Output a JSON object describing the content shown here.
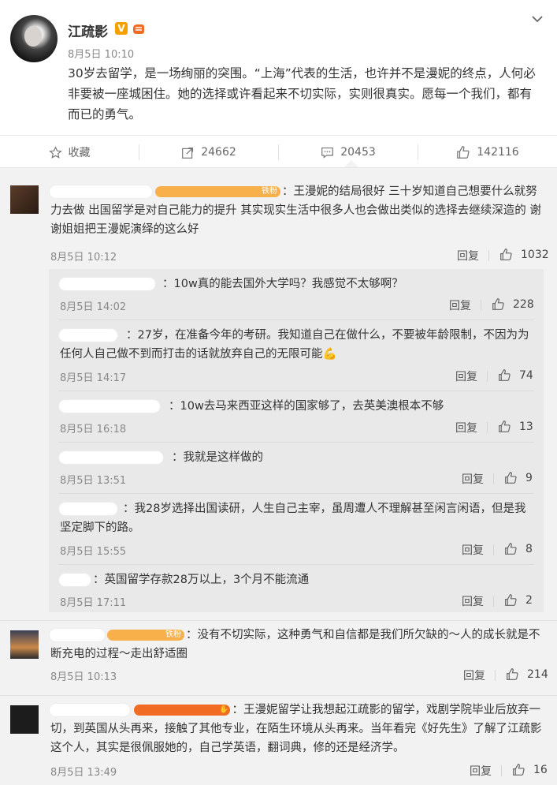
{
  "post": {
    "author": "江疏影",
    "verified_badge": "V",
    "time": "8月5日 10:10",
    "text": "30岁去留学，是一场绚丽的突围。“上海”代表的生活，也许并不是漫妮的终点，人何必非要被一座城困住。她的选择或许看起来不切实际，实则很真实。愿每一个我们，都有而已的勇气。"
  },
  "actions": {
    "collect": {
      "label": "收藏",
      "icon": "star-icon"
    },
    "forward": {
      "label": "24662",
      "icon": "share-icon"
    },
    "comment": {
      "label": "20453",
      "icon": "comment-icon"
    },
    "like": {
      "label": "142116",
      "icon": "thumbs-up-icon"
    }
  },
  "comments": [
    {
      "badge": "铁粉",
      "text": "：王漫妮的结局很好 三十岁知道自己想要什么就努力去做 出国留学是对自己能力的提升 其实现实生活中很多人也会做出类似的选择去继续深造的 谢谢姐姐把王漫妮演绎的这么好",
      "time": "8月5日 10:12",
      "reply": "回复",
      "likes": "1032",
      "replies": [
        {
          "text": "：10w真的能去国外大学吗？我感觉不太够啊？",
          "time": "8月5日 14:02",
          "reply": "回复",
          "likes": "228"
        },
        {
          "text": "：27岁，在准备今年的考研。我知道自己在做什么，不要被年龄限制，不因为为任何人自己做不到而打击的话就放弃自己的无限可能💪",
          "time": "8月5日 14:17",
          "reply": "回复",
          "likes": "74"
        },
        {
          "text": "：10w去马来西亚这样的国家够了，去英美澳根本不够",
          "time": "8月5日 16:18",
          "reply": "回复",
          "likes": "13"
        },
        {
          "text": "：我就是这样做的",
          "time": "8月5日 13:51",
          "reply": "回复",
          "likes": "9"
        },
        {
          "text": "：我28岁选择出国读研，人生自己主宰，虽周遭人不理解甚至闲言闲语，但是我坚定脚下的路。",
          "time": "8月5日 15:55",
          "reply": "回复",
          "likes": "8"
        },
        {
          "text": "：英国留学存款28万以上，3个月不能流通",
          "time": "8月5日 17:11",
          "reply": "回复",
          "likes": "2"
        }
      ]
    },
    {
      "badge": "铁粉",
      "text": "：没有不切实际，这种勇气和自信都是我们所欠缺的～人的成长就是不断充电的过程～走出舒适圈",
      "time": "8月5日 10:13",
      "reply": "回复",
      "likes": "214"
    },
    {
      "text": "：王漫妮留学让我想起江疏影的留学，戏剧学院毕业后放弃一切，到英国从头再来，接触了其他专业，在陌生环境从头再来。当年看完《好先生》了解了江疏影这个人，其实是很佩服她的，自己学英语，翻词典，修的还是经济学。",
      "time": "8月5日 13:49",
      "reply": "回复",
      "likes": "16"
    }
  ],
  "colors": {
    "background": "#f2f2f2",
    "subpanel": "#e9e9e9",
    "badge": "#f7b04a",
    "vip": "#f6a000"
  }
}
